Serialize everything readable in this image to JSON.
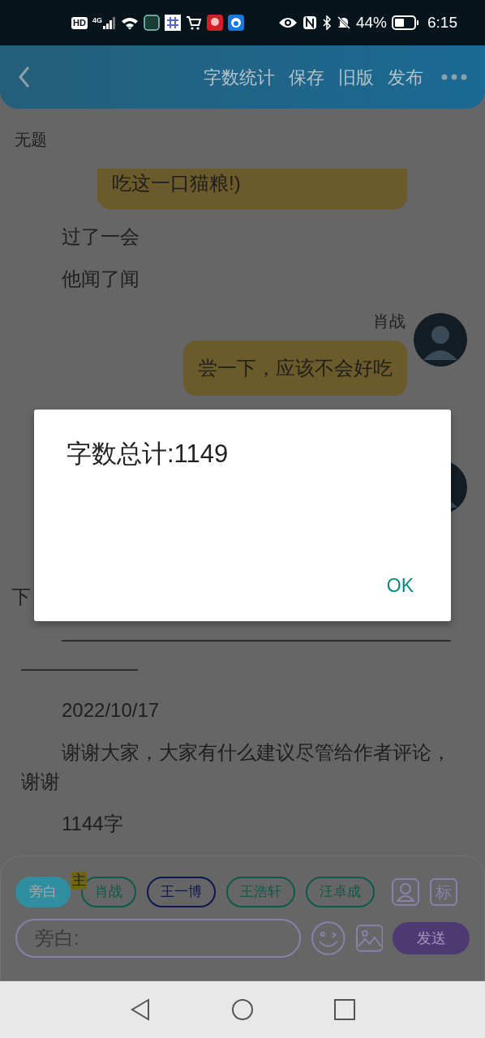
{
  "status_bar": {
    "badges": [
      "HD",
      "4G"
    ],
    "battery": "44%",
    "time": "6:15"
  },
  "header": {
    "actions": [
      "字数统计",
      "保存",
      "旧版",
      "发布"
    ]
  },
  "title": "无题",
  "story": [
    {
      "kind": "bubble",
      "text": "吃这一口猫粮!)"
    },
    {
      "kind": "narration",
      "text": "过了一会"
    },
    {
      "kind": "narration",
      "text": "他闻了闻"
    },
    {
      "kind": "message",
      "speaker": "肖战",
      "text": "尝一下，应该不会好吃"
    },
    {
      "kind": "avatar"
    },
    {
      "kind": "continuation",
      "text": "下"
    },
    {
      "kind": "narration",
      "text": "——————————————————————————"
    },
    {
      "kind": "narration",
      "text": "2022/10/17"
    },
    {
      "kind": "narration",
      "text": "谢谢大家，大家有什么建议尽管给作者评论，谢谢"
    },
    {
      "kind": "narration",
      "text": "1144字"
    }
  ],
  "composer": {
    "roles": [
      {
        "label": "旁白",
        "selected": true,
        "color": "#2f8ea0"
      },
      {
        "label": "肖战",
        "selected": false,
        "color": "#0e5a48",
        "badge": "主"
      },
      {
        "label": "王一博",
        "selected": false,
        "color": "#0c1850"
      },
      {
        "label": "王浩轩",
        "selected": false,
        "color": "#0e5a48"
      },
      {
        "label": "汪卓成",
        "selected": false,
        "color": "#0e5a48"
      }
    ],
    "tag_button": "标",
    "input": {
      "placeholder": "旁白:"
    },
    "send": "发送"
  },
  "dialog": {
    "message": "字数总计:1149",
    "button": "OK"
  }
}
